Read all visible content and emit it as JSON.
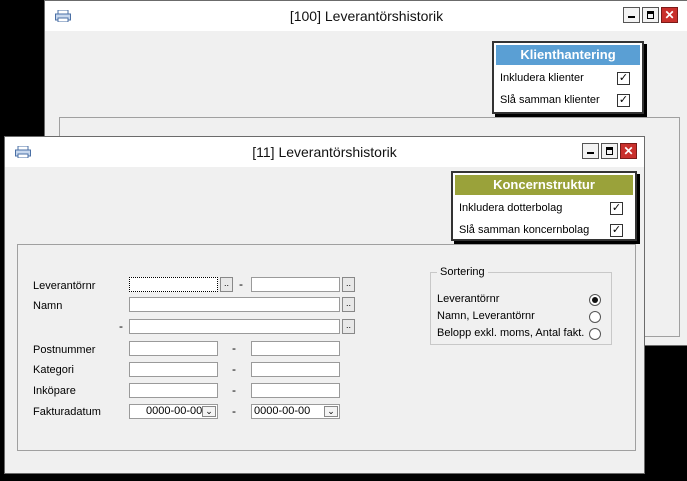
{
  "back_window": {
    "title": "[100]  Leverantörshistorik",
    "panel": {
      "header": "Klienthantering",
      "header_color": "#5a9fd4",
      "rows": [
        {
          "label": "Inkludera klienter",
          "checked": true
        },
        {
          "label": "Slå samman klienter",
          "checked": true
        }
      ]
    }
  },
  "front_window": {
    "title": "[11]  Leverantörshistorik",
    "panel": {
      "header": "Koncernstruktur",
      "header_color": "#9aa23a",
      "rows": [
        {
          "label": "Inkludera dotterbolag",
          "checked": true
        },
        {
          "label": "Slå samman koncernbolag",
          "checked": true
        }
      ]
    },
    "form": {
      "leverantornr_label": "Leverantörnr",
      "namn_label": "Namn",
      "postnummer_label": "Postnummer",
      "kategori_label": "Kategori",
      "inkopare_label": "Inköpare",
      "fakturadatum_label": "Fakturadatum",
      "range_dash": "-",
      "lookup_btn": "..",
      "date_from": "0000-00-00",
      "date_to": "0000-00-00"
    },
    "sortering": {
      "legend": "Sortering",
      "options": [
        {
          "label": "Leverantörnr",
          "selected": true
        },
        {
          "label": "Namn, Leverantörnr",
          "selected": false
        },
        {
          "label": "Belopp exkl. moms, Antal fakt.",
          "selected": false
        }
      ]
    }
  },
  "window_buttons": {
    "close": "✕"
  }
}
